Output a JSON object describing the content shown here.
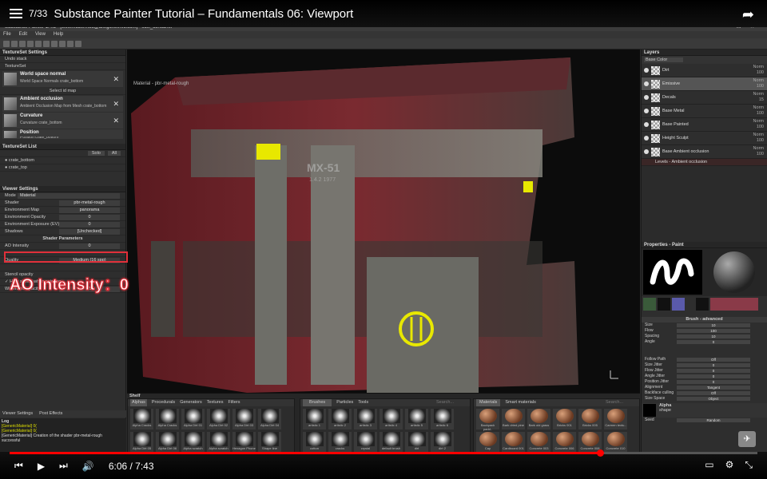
{
  "youtube": {
    "playlist_index": "7/33",
    "video_title": "Substance Painter Tutorial – Fundamentals 06: Viewport",
    "time": "6:06 / 7:43",
    "progress": 0.79
  },
  "app": {
    "window_title": "Substance Painter 1.4.2 - [wes.mcdermott@allegorithmic.com] - scifi_container",
    "menu": [
      "File",
      "Edit",
      "View",
      "Help"
    ]
  },
  "textureset_settings": {
    "title": "TextureSet Settings",
    "undo": "Undo stack",
    "textureset_label": "TextureSet",
    "maps": [
      {
        "name": "World space normal",
        "desc": "World Space Normals crate_bottom"
      },
      {
        "name": "Ambient occlusion",
        "desc": "Ambient Occlusion Map from Mesh crate_bottom"
      },
      {
        "name": "Curvature",
        "desc": "Curvature crate_bottom"
      },
      {
        "name": "Position",
        "desc": "Position crate_bottom"
      }
    ],
    "select_id": "Select id map"
  },
  "textureset_list": {
    "title": "TextureSet List",
    "solo": "Solo",
    "all": "All",
    "items": [
      "crate_bottom",
      "crate_top"
    ]
  },
  "viewer_settings": {
    "title": "Viewer Settings",
    "mode_label": "Mode",
    "mode": "Material",
    "shader_label": "Shader",
    "shader": "pbr-metal-rough",
    "envmap_label": "Environment Map",
    "envmap": "panorama",
    "env_opacity_label": "Environment Opacity",
    "env_opacity": "0",
    "env_exposure_label": "Environment Exposure (EV)",
    "env_exposure": "0",
    "shadows_label": "Shadows",
    "shadows": "[Unchecked]",
    "shader_params": "Shader Parameters",
    "ao_label": "AO Intensity",
    "ao": "0",
    "quality_label": "Quality",
    "quality": "Medium (16 spp)",
    "stencil": "Stencil opacity",
    "hide_stencil": "Hide stencil when painting",
    "wire_label": "Wireframe opacity",
    "wire": "75"
  },
  "annotation": "AO Intensity：0",
  "bottom_tabs": [
    "Viewer Settings",
    "Post Effects"
  ],
  "log": {
    "title": "Log",
    "lines": [
      "[GenericMaterial] 0(",
      "[GenericMaterial] 0(",
      "[GenericMaterial] Creation of the shader pbr-metal-rough",
      "successful"
    ]
  },
  "viewport": {
    "label": "Material - pbr-metal-rough",
    "stencil_text": "MX-51",
    "stencil_sub": "1.4.2 1977"
  },
  "layers": {
    "title": "Layers",
    "channel": "Base Color",
    "items": [
      {
        "name": "Dirt",
        "blend": "Norm",
        "op": "100"
      },
      {
        "name": "Emissive",
        "blend": "Norm",
        "op": "100"
      },
      {
        "name": "Decals",
        "blend": "Norm",
        "op": "15"
      },
      {
        "name": "Base Metal",
        "blend": "Norm",
        "op": "100"
      },
      {
        "name": "Base Painted",
        "blend": "Norm",
        "op": "100"
      },
      {
        "name": "Height Sculpt",
        "blend": "Norm",
        "op": "100"
      },
      {
        "name": "Base Ambient occlusion",
        "blend": "Norm",
        "op": "100"
      }
    ],
    "effect": "Levels - Ambient occlusion"
  },
  "properties": {
    "title": "Properties - Paint",
    "slots": [
      "brush",
      "alpha",
      "stencil"
    ],
    "section": "Brush - advanced",
    "rows": [
      {
        "l": "Size",
        "v": "10"
      },
      {
        "l": "Flow",
        "v": "100"
      },
      {
        "l": "Spacing",
        "v": "10"
      },
      {
        "l": "Angle",
        "v": "0"
      },
      {
        "l": "Follow Path",
        "v": "Off"
      },
      {
        "l": "Size Jitter",
        "v": "0"
      },
      {
        "l": "Flow Jitter",
        "v": "0"
      },
      {
        "l": "Angle Jitter",
        "v": "0"
      },
      {
        "l": "Position Jitter",
        "v": "0"
      },
      {
        "l": "Alignment",
        "v": "Tangent"
      },
      {
        "l": "Backface culling",
        "v": "Off"
      },
      {
        "l": "Size Space",
        "v": "Object"
      }
    ],
    "alpha_title": "Alpha",
    "alpha_sub": "shape",
    "seed_label": "Seed",
    "seed": "Random"
  },
  "shelf": {
    "title": "Shelf",
    "tabs": [
      "Alphas",
      "Procedurals",
      "Generators",
      "Textures",
      "Filters"
    ],
    "alphas": [
      "Alpha Cracks",
      "Alpha Cracks",
      "Alpha Dirt 01",
      "Alpha Dirt 02",
      "Alpha Dirt 03",
      "Alpha Dirt 04",
      "Alpha Dirt 05",
      "Alpha Dirt 06",
      "Alpha scratch",
      "Alpha scratch",
      "Hexagon Phone",
      "Shape line"
    ],
    "brush_tabs": [
      "Brushes",
      "Particles",
      "Tools"
    ],
    "brushes": [
      "artistic 1",
      "artistic 2",
      "artistic 3",
      "artistic 4",
      "artistic 5",
      "artistic 6",
      "cotton",
      "cracks",
      "crystal",
      "default brush",
      "dirt",
      "dirt 2"
    ],
    "mat_tabs": [
      "Materials",
      "Smart materials"
    ],
    "materials": [
      "Backpack padd..",
      "Bark dried pine",
      "Bark old grass",
      "Bricks 001",
      "Bricks 005",
      "Carmen textu..",
      "Cap",
      "Cardboard 001",
      "Concrete 003",
      "Concrete 006",
      "Concrete 008",
      "Concrete 010"
    ],
    "search": "Search..."
  }
}
